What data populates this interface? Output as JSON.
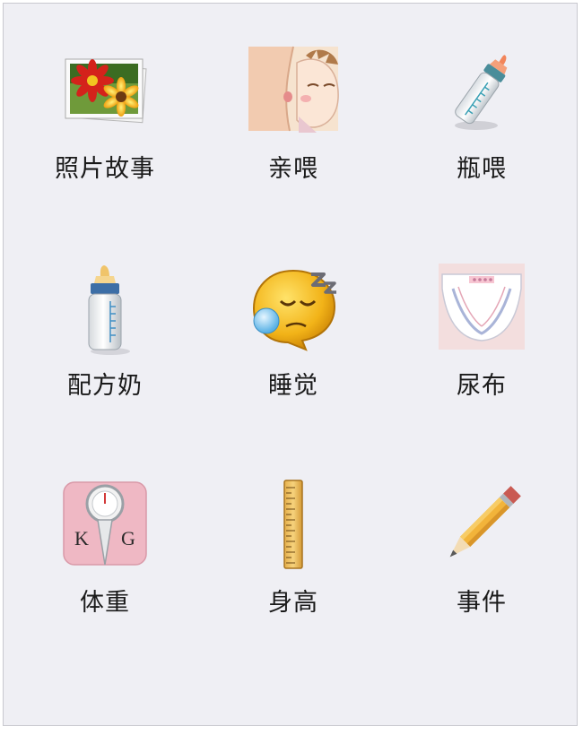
{
  "items": [
    {
      "label": "照片故事",
      "icon": "photo-gallery-icon"
    },
    {
      "label": "亲喂",
      "icon": "breastfeeding-icon"
    },
    {
      "label": "瓶喂",
      "icon": "feeding-bottle-icon"
    },
    {
      "label": "配方奶",
      "icon": "formula-bottle-icon"
    },
    {
      "label": "睡觉",
      "icon": "sleeping-face-icon"
    },
    {
      "label": "尿布",
      "icon": "diaper-icon"
    },
    {
      "label": "体重",
      "icon": "weight-scale-icon"
    },
    {
      "label": "身高",
      "icon": "ruler-icon"
    },
    {
      "label": "事件",
      "icon": "pencil-icon"
    }
  ],
  "scale": {
    "left": "K",
    "right": "G"
  }
}
